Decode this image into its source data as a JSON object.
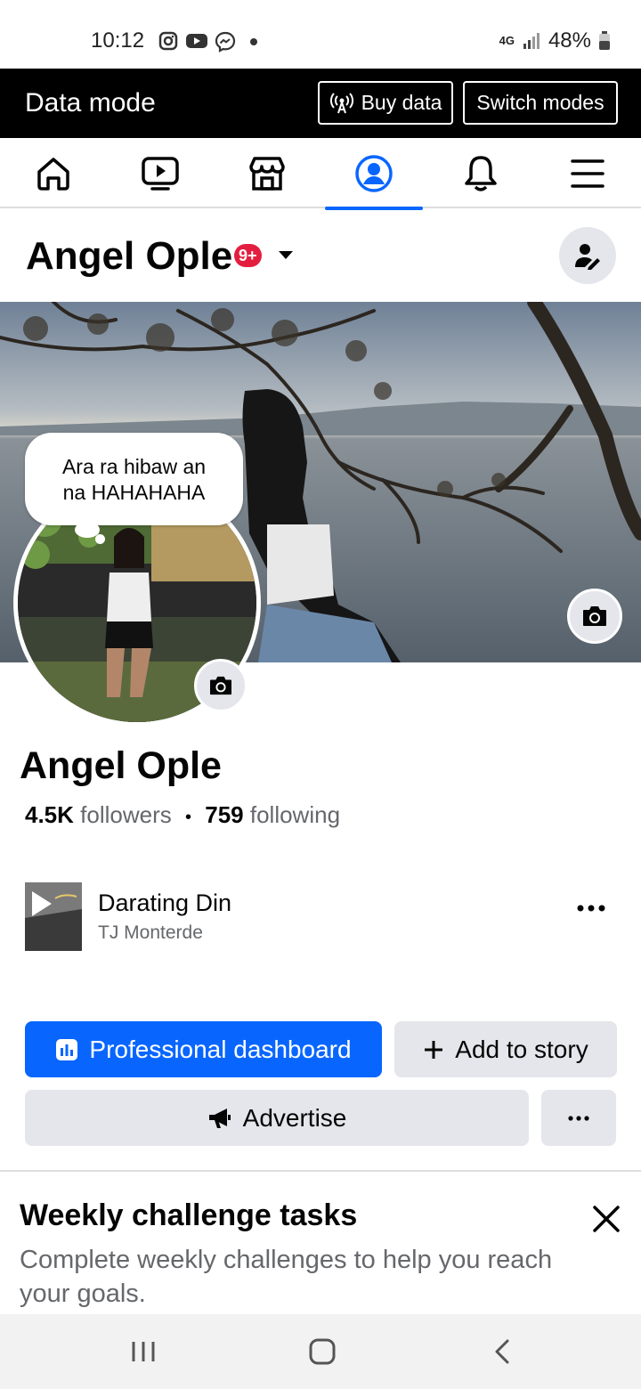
{
  "status_bar": {
    "time": "10:12",
    "network": "4G",
    "battery": "48%",
    "notification_icons": [
      "instagram-icon",
      "youtube-icon",
      "messenger-icon",
      "more-dot-icon"
    ]
  },
  "data_mode": {
    "title": "Data mode",
    "buy_label": "Buy data",
    "switch_label": "Switch modes"
  },
  "tabs": [
    {
      "name": "home",
      "icon": "home-icon"
    },
    {
      "name": "video",
      "icon": "video-icon"
    },
    {
      "name": "marketplace",
      "icon": "marketplace-icon"
    },
    {
      "name": "profile",
      "icon": "profile-icon",
      "active": true
    },
    {
      "name": "notifications",
      "icon": "bell-icon"
    },
    {
      "name": "menu",
      "icon": "menu-icon"
    }
  ],
  "profile_header": {
    "name": "Angel Ople",
    "badge": "9+"
  },
  "note_bubble": {
    "text_line1": "Ara ra hibaw an",
    "text_line2": "na HAHAHAHA"
  },
  "profile": {
    "name": "Angel Ople",
    "followers_count": "4.5K",
    "followers_label": "followers",
    "separator": "•",
    "following_count": "759",
    "following_label": "following"
  },
  "music": {
    "title": "Darating Din",
    "artist": "TJ Monterde"
  },
  "actions": {
    "dashboard_label": "Professional dashboard",
    "story_label": "Add to story",
    "advertise_label": "Advertise"
  },
  "weekly": {
    "title": "Weekly challenge tasks",
    "description": "Complete weekly challenges to help you reach your goals."
  },
  "colors": {
    "accent": "#0866ff",
    "badge": "#e41e3f",
    "button_gray": "#e4e6eb",
    "secondary_text": "#65676b"
  }
}
